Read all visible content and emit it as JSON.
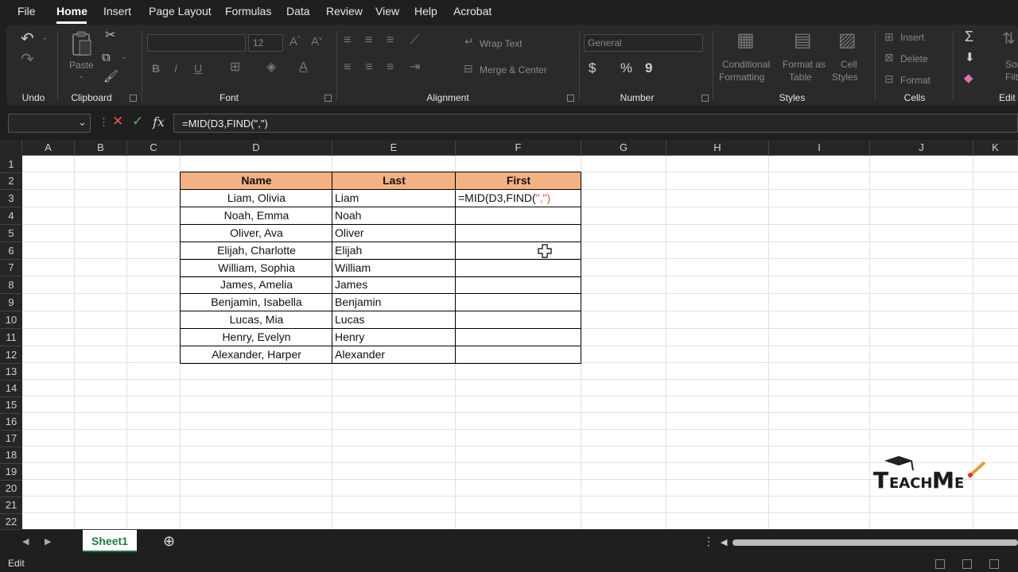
{
  "menu": {
    "items": [
      "File",
      "Home",
      "Insert",
      "Page Layout",
      "Formulas",
      "Data",
      "Review",
      "View",
      "Help",
      "Acrobat"
    ],
    "active": "Home"
  },
  "ribbon": {
    "groups": {
      "undo": "Undo",
      "clipboard": "Clipboard",
      "font": "Font",
      "alignment": "Alignment",
      "number": "Number",
      "styles": "Styles",
      "cells": "Cells",
      "editing": "Edit"
    },
    "paste_label": "Paste",
    "font_size": "12",
    "bold": "B",
    "italic": "I",
    "underline": "U",
    "wrap_text": "Wrap Text",
    "merge_center": "Merge & Center",
    "number_format": "General",
    "currency": "$",
    "percent": "%",
    "comma": "9",
    "conditional_formatting": [
      "Conditional",
      "Formatting"
    ],
    "format_as_table": [
      "Format as",
      "Table"
    ],
    "cell_styles": [
      "Cell",
      "Styles"
    ],
    "insert": "Insert",
    "delete": "Delete",
    "format": "Format",
    "sort_filter": [
      "Sort",
      "Filte"
    ],
    "sigma": "Σ"
  },
  "formula_bar": {
    "name_box": "",
    "fx": "fx",
    "formula": "=MID(D3,FIND(\",\")"
  },
  "columns": [
    "A",
    "B",
    "C",
    "D",
    "E",
    "F",
    "G",
    "H",
    "I",
    "J",
    "K"
  ],
  "rows": [
    "1",
    "2",
    "3",
    "4",
    "5",
    "6",
    "7",
    "8",
    "9",
    "10",
    "11",
    "12",
    "13",
    "14",
    "15",
    "16",
    "17",
    "18",
    "19",
    "20",
    "21",
    "22"
  ],
  "table": {
    "headers": [
      "Name",
      "Last",
      "First"
    ],
    "rows": [
      {
        "name": "Liam, Olivia",
        "last": "Liam",
        "first_prefix": "=MID(D3,FIND(",
        "first_suffix": "\",\")"
      },
      {
        "name": "Noah, Emma",
        "last": "Noah",
        "first_prefix": "",
        "first_suffix": ""
      },
      {
        "name": "Oliver, Ava",
        "last": "Oliver",
        "first_prefix": "",
        "first_suffix": ""
      },
      {
        "name": "Elijah, Charlotte",
        "last": "Elijah",
        "first_prefix": "",
        "first_suffix": ""
      },
      {
        "name": "William, Sophia",
        "last": "William",
        "first_prefix": "",
        "first_suffix": ""
      },
      {
        "name": "James, Amelia",
        "last": "James",
        "first_prefix": "",
        "first_suffix": ""
      },
      {
        "name": "Benjamin, Isabella",
        "last": "Benjamin",
        "first_prefix": "",
        "first_suffix": ""
      },
      {
        "name": "Lucas, Mia",
        "last": "Lucas",
        "first_prefix": "",
        "first_suffix": ""
      },
      {
        "name": "Henry, Evelyn",
        "last": "Henry",
        "first_prefix": "",
        "first_suffix": ""
      },
      {
        "name": "Alexander, Harper",
        "last": "Alexander",
        "first_prefix": "",
        "first_suffix": ""
      }
    ]
  },
  "watermark": "TEACHME",
  "sheet_tab": "Sheet1",
  "status": "Edit",
  "colors": {
    "header_fill": "#f4b183",
    "accent_green": "#1e7b3c",
    "formula_red": "#e0504a"
  }
}
